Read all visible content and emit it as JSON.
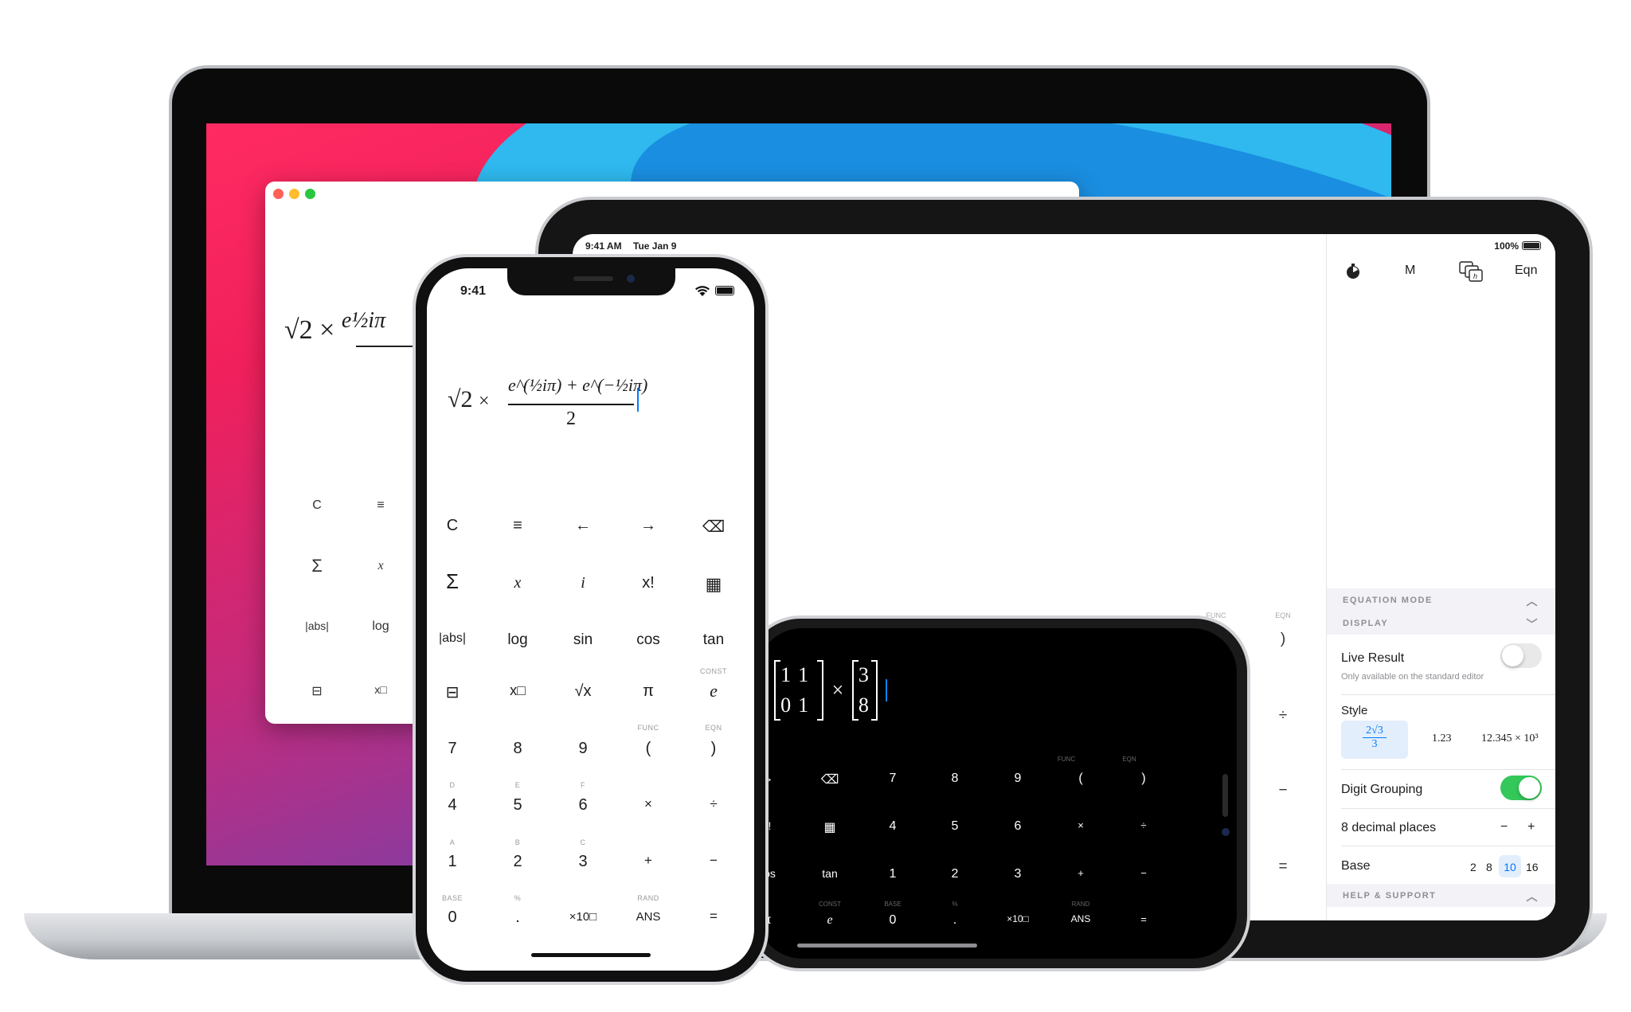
{
  "mac": {
    "window_keys": [
      "C",
      "≡",
      "Σ",
      "x",
      "|abs|",
      "log",
      "⊟",
      "x□"
    ],
    "expression": {
      "radical": "√2",
      "times": "×",
      "numerator": "e½iπ"
    }
  },
  "ipad": {
    "status_time": "9:41 AM",
    "status_date": "Tue Jan 9",
    "battery": "100%",
    "toolbar": {
      "timer_icon": "timer-icon",
      "memory_label": "M",
      "functions_icon": "functions-icon",
      "eqn_label": "Eqn"
    },
    "right_keys": [
      ")",
      "÷",
      "−",
      "="
    ],
    "right_key_labels": [
      "FUNC",
      "EQN"
    ],
    "settings": {
      "equation_mode_header": "EQUATION MODE",
      "display_header": "DISPLAY",
      "live_result_label": "Live Result",
      "live_result_sub": "Only available on the standard editor",
      "live_result_on": false,
      "style_label": "Style",
      "style_options": [
        "2√3 / 3",
        "1.23",
        "12.345 × 10³"
      ],
      "style_selected": 0,
      "digit_grouping_label": "Digit Grouping",
      "digit_grouping_on": true,
      "decimal_label": "8 decimal places",
      "decimal_minus": "−",
      "decimal_plus": "+",
      "base_label": "Base",
      "base_options": [
        "2",
        "8",
        "10",
        "16"
      ],
      "base_selected": "10",
      "help_header": "HELP & SUPPORT"
    },
    "accent_color": "#007aff",
    "toggle_on_color": "#34c759"
  },
  "iphone_portrait": {
    "status_time": "9:41",
    "expression": {
      "radical": "√2",
      "times": "×",
      "numerator": "e^(½iπ) + e^(−½iπ)",
      "denominator": "2"
    },
    "keys": [
      [
        "C",
        "≡",
        "←",
        "→",
        "⌫"
      ],
      [
        "Σ",
        "x",
        "i",
        "x!",
        "▦"
      ],
      [
        "|abs|",
        "log",
        "sin",
        "cos",
        "tan"
      ],
      [
        "⊟",
        "x□",
        "√x",
        "π",
        "e"
      ],
      [
        "7",
        "8",
        "9",
        "(",
        ")"
      ],
      [
        "4",
        "5",
        "6",
        "×",
        "÷"
      ],
      [
        "1",
        "2",
        "3",
        "+",
        "−"
      ],
      [
        "0",
        ".",
        "×10□",
        "ANS",
        "="
      ]
    ],
    "sublabels": {
      "const": "CONST",
      "func": "FUNC",
      "eqn": "EQN",
      "d": "D",
      "e": "E",
      "f": "F",
      "a": "A",
      "b": "B",
      "c": "C",
      "base": "BASE",
      "percent": "%",
      "rand": "RAND"
    }
  },
  "iphone_landscape": {
    "expression": {
      "times": "×"
    },
    "keys": [
      [
        "→",
        "⌫",
        "7",
        "8",
        "9",
        "(",
        ")"
      ],
      [
        "x!",
        "▦",
        "4",
        "5",
        "6",
        "×",
        "÷"
      ],
      [
        "cos",
        "tan",
        "1",
        "2",
        "3",
        "+",
        "−"
      ],
      [
        "π",
        "e",
        "0",
        ".",
        "×10□",
        "ANS",
        "="
      ]
    ],
    "sublabels": {
      "func": "FUNC",
      "eqn": "EQN",
      "const": "CONST",
      "base": "BASE",
      "percent": "%",
      "rand": "RAND"
    }
  }
}
